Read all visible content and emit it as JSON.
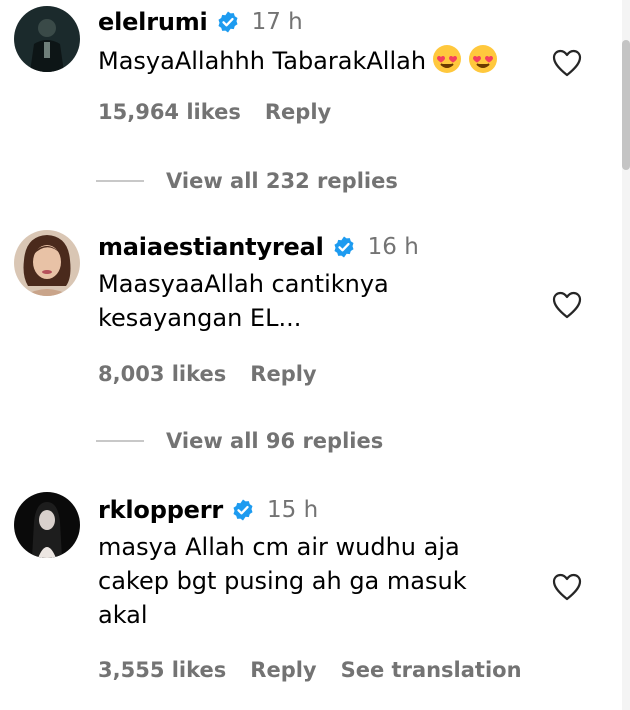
{
  "comments": [
    {
      "username": "elelrumi",
      "time": "17 h",
      "text_lines": [
        "MasyaAllahhh TabarakAllah"
      ],
      "emoji": [
        "heart-eyes-emoji",
        "heart-eyes-emoji"
      ],
      "likes": "15,964 likes",
      "reply": "Reply",
      "view_replies": "View all 232 replies"
    },
    {
      "username": "maiaestiantyreal",
      "time": "16 h",
      "text_lines": [
        "MaasyaaAllah cantiknya",
        "kesayangan EL..."
      ],
      "likes": "8,003 likes",
      "reply": "Reply",
      "view_replies": "View all 96 replies"
    },
    {
      "username": "rklopperr",
      "time": "15 h",
      "text_lines": [
        "masya Allah cm air wudhu aja",
        "cakep bgt pusing ah ga masuk",
        "akal"
      ],
      "likes": "3,555 likes",
      "reply": "Reply",
      "see_translation": "See translation"
    }
  ],
  "colors": {
    "verified": "#1d9bf0",
    "secondary_text": "#737373",
    "primary_text": "#000000"
  }
}
